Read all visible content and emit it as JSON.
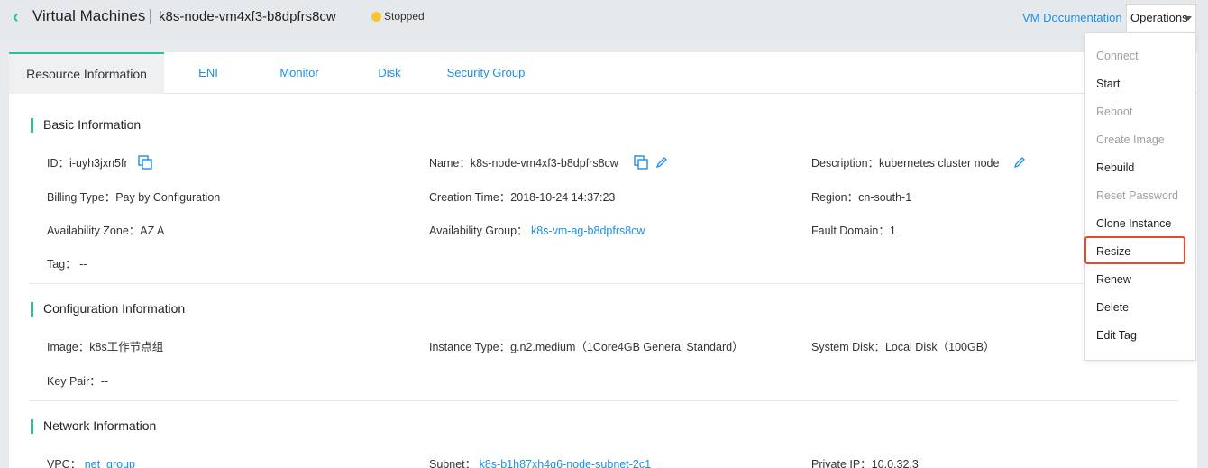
{
  "header": {
    "crumb": "Virtual Machines",
    "vm_name": "k8s-node-vm4xf3-b8dpfrs8cw",
    "status": "Stopped",
    "doc_link": "VM Documentation",
    "operations": "Operations"
  },
  "tabs": [
    "Resource Information",
    "ENI",
    "Monitor",
    "Disk",
    "Security Group"
  ],
  "basic": {
    "title": "Basic Information",
    "id": "ID：i-uyh3jxn5fr",
    "name": "Name：k8s-node-vm4xf3-b8dpfrs8cw",
    "description": "Description：kubernetes cluster node",
    "billing": "Billing Type：Pay by Configuration",
    "creation": "Creation Time：2018-10-24 14:37:23",
    "region": "Region：cn-south-1",
    "az": "Availability Zone：AZ A",
    "ag_label": "Availability Group：",
    "ag_value": "k8s-vm-ag-b8dpfrs8cw",
    "fault": "Fault Domain：1",
    "tag": "Tag： --"
  },
  "config": {
    "title": "Configuration Information",
    "image": "Image：k8s工作节点组",
    "instance_type": "Instance Type：g.n2.medium（1Core4GB General Standard）",
    "system_disk": "System Disk：Local Disk（100GB）",
    "key_pair": "Key Pair：--"
  },
  "network": {
    "title": "Network Information",
    "vpc_label": "VPC：",
    "vpc_value": "net_group",
    "subnet_label": "Subnet：",
    "subnet_value": "k8s-b1h87xh4q6-node-subnet-2c1",
    "private_ip": "Private IP：10.0.32.3"
  },
  "menu": [
    {
      "label": "Connect",
      "disabled": true
    },
    {
      "label": "Start",
      "disabled": false
    },
    {
      "label": "Reboot",
      "disabled": true
    },
    {
      "label": "Create Image",
      "disabled": true
    },
    {
      "label": "Rebuild",
      "disabled": false
    },
    {
      "label": "Reset Password",
      "disabled": true
    },
    {
      "label": "Clone Instance",
      "disabled": false
    },
    {
      "label": "Resize",
      "disabled": false
    },
    {
      "label": "Renew",
      "disabled": false
    },
    {
      "label": "Delete",
      "disabled": false
    },
    {
      "label": "Edit Tag",
      "disabled": false
    }
  ],
  "colors": {
    "accent": "#2bbf9a",
    "link": "#1c8fe0",
    "status": "#f7c531",
    "highlight": "#e64b2e"
  }
}
